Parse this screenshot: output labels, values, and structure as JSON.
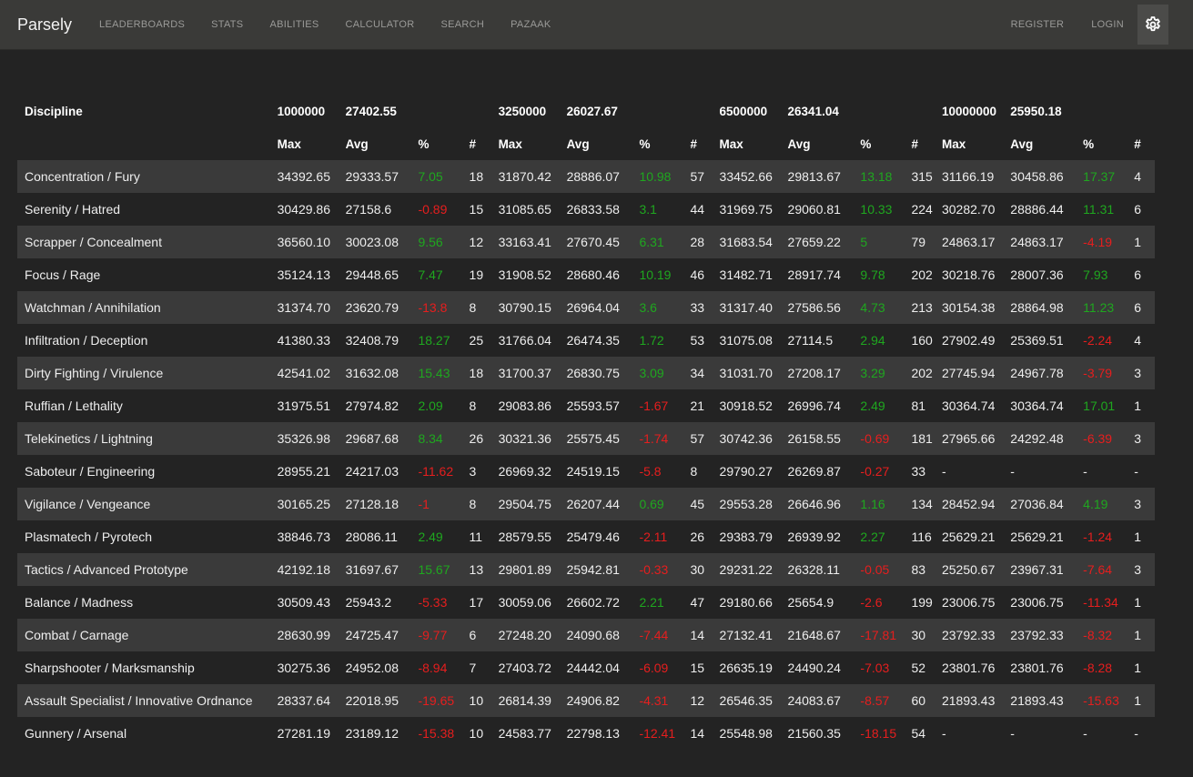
{
  "nav": {
    "brand": "Parsely",
    "links": [
      "LEADERBOARDS",
      "STATS",
      "ABILITIES",
      "CALCULATOR",
      "SEARCH",
      "PAZAAK"
    ],
    "register": "REGISTER",
    "login": "LOGIN"
  },
  "table": {
    "discipline_header": "Discipline",
    "groups": [
      {
        "hp": "1000000",
        "avg": "27402.55"
      },
      {
        "hp": "3250000",
        "avg": "26027.67"
      },
      {
        "hp": "6500000",
        "avg": "26341.04"
      },
      {
        "hp": "10000000",
        "avg": "25950.18"
      }
    ],
    "sub_headers": {
      "max": "Max",
      "avg": "Avg",
      "pct": "%",
      "count": "#"
    },
    "colors": {
      "positive": "#1fa71f",
      "negative": "#e61e1e"
    },
    "rows": [
      {
        "name": "Concentration / Fury",
        "cells": [
          [
            "34392.65",
            "29333.57",
            "7.05",
            "18"
          ],
          [
            "31870.42",
            "28886.07",
            "10.98",
            "57"
          ],
          [
            "33452.66",
            "29813.67",
            "13.18",
            "315"
          ],
          [
            "31166.19",
            "30458.86",
            "17.37",
            "4"
          ]
        ]
      },
      {
        "name": "Serenity / Hatred",
        "cells": [
          [
            "30429.86",
            "27158.6",
            "-0.89",
            "15"
          ],
          [
            "31085.65",
            "26833.58",
            "3.1",
            "44"
          ],
          [
            "31969.75",
            "29060.81",
            "10.33",
            "224"
          ],
          [
            "30282.70",
            "28886.44",
            "11.31",
            "6"
          ]
        ]
      },
      {
        "name": "Scrapper / Concealment",
        "cells": [
          [
            "36560.10",
            "30023.08",
            "9.56",
            "12"
          ],
          [
            "33163.41",
            "27670.45",
            "6.31",
            "28"
          ],
          [
            "31683.54",
            "27659.22",
            "5",
            "79"
          ],
          [
            "24863.17",
            "24863.17",
            "-4.19",
            "1"
          ]
        ]
      },
      {
        "name": "Focus / Rage",
        "cells": [
          [
            "35124.13",
            "29448.65",
            "7.47",
            "19"
          ],
          [
            "31908.52",
            "28680.46",
            "10.19",
            "46"
          ],
          [
            "31482.71",
            "28917.74",
            "9.78",
            "202"
          ],
          [
            "30218.76",
            "28007.36",
            "7.93",
            "6"
          ]
        ]
      },
      {
        "name": "Watchman / Annihilation",
        "cells": [
          [
            "31374.70",
            "23620.79",
            "-13.8",
            "8"
          ],
          [
            "30790.15",
            "26964.04",
            "3.6",
            "33"
          ],
          [
            "31317.40",
            "27586.56",
            "4.73",
            "213"
          ],
          [
            "30154.38",
            "28864.98",
            "11.23",
            "6"
          ]
        ]
      },
      {
        "name": "Infiltration / Deception",
        "cells": [
          [
            "41380.33",
            "32408.79",
            "18.27",
            "25"
          ],
          [
            "31766.04",
            "26474.35",
            "1.72",
            "53"
          ],
          [
            "31075.08",
            "27114.5",
            "2.94",
            "160"
          ],
          [
            "27902.49",
            "25369.51",
            "-2.24",
            "4"
          ]
        ]
      },
      {
        "name": "Dirty Fighting / Virulence",
        "cells": [
          [
            "42541.02",
            "31632.08",
            "15.43",
            "18"
          ],
          [
            "31700.37",
            "26830.75",
            "3.09",
            "34"
          ],
          [
            "31031.70",
            "27208.17",
            "3.29",
            "202"
          ],
          [
            "27745.94",
            "24967.78",
            "-3.79",
            "3"
          ]
        ]
      },
      {
        "name": "Ruffian / Lethality",
        "cells": [
          [
            "31975.51",
            "27974.82",
            "2.09",
            "8"
          ],
          [
            "29083.86",
            "25593.57",
            "-1.67",
            "21"
          ],
          [
            "30918.52",
            "26996.74",
            "2.49",
            "81"
          ],
          [
            "30364.74",
            "30364.74",
            "17.01",
            "1"
          ]
        ]
      },
      {
        "name": "Telekinetics / Lightning",
        "cells": [
          [
            "35326.98",
            "29687.68",
            "8.34",
            "26"
          ],
          [
            "30321.36",
            "25575.45",
            "-1.74",
            "57"
          ],
          [
            "30742.36",
            "26158.55",
            "-0.69",
            "181"
          ],
          [
            "27965.66",
            "24292.48",
            "-6.39",
            "3"
          ]
        ]
      },
      {
        "name": "Saboteur / Engineering",
        "cells": [
          [
            "28955.21",
            "24217.03",
            "-11.62",
            "3"
          ],
          [
            "26969.32",
            "24519.15",
            "-5.8",
            "8"
          ],
          [
            "29790.27",
            "26269.87",
            "-0.27",
            "33"
          ],
          [
            "-",
            "-",
            "-",
            "-"
          ]
        ]
      },
      {
        "name": "Vigilance / Vengeance",
        "cells": [
          [
            "30165.25",
            "27128.18",
            "-1",
            "8"
          ],
          [
            "29504.75",
            "26207.44",
            "0.69",
            "45"
          ],
          [
            "29553.28",
            "26646.96",
            "1.16",
            "134"
          ],
          [
            "28452.94",
            "27036.84",
            "4.19",
            "3"
          ]
        ]
      },
      {
        "name": "Plasmatech / Pyrotech",
        "cells": [
          [
            "38846.73",
            "28086.11",
            "2.49",
            "11"
          ],
          [
            "28579.55",
            "25479.46",
            "-2.11",
            "26"
          ],
          [
            "29383.79",
            "26939.92",
            "2.27",
            "116"
          ],
          [
            "25629.21",
            "25629.21",
            "-1.24",
            "1"
          ]
        ]
      },
      {
        "name": "Tactics / Advanced Prototype",
        "cells": [
          [
            "42192.18",
            "31697.67",
            "15.67",
            "13"
          ],
          [
            "29801.89",
            "25942.81",
            "-0.33",
            "30"
          ],
          [
            "29231.22",
            "26328.11",
            "-0.05",
            "83"
          ],
          [
            "25250.67",
            "23967.31",
            "-7.64",
            "3"
          ]
        ]
      },
      {
        "name": "Balance / Madness",
        "cells": [
          [
            "30509.43",
            "25943.2",
            "-5.33",
            "17"
          ],
          [
            "30059.06",
            "26602.72",
            "2.21",
            "47"
          ],
          [
            "29180.66",
            "25654.9",
            "-2.6",
            "199"
          ],
          [
            "23006.75",
            "23006.75",
            "-11.34",
            "1"
          ]
        ]
      },
      {
        "name": "Combat / Carnage",
        "cells": [
          [
            "28630.99",
            "24725.47",
            "-9.77",
            "6"
          ],
          [
            "27248.20",
            "24090.68",
            "-7.44",
            "14"
          ],
          [
            "27132.41",
            "21648.67",
            "-17.81",
            "30"
          ],
          [
            "23792.33",
            "23792.33",
            "-8.32",
            "1"
          ]
        ]
      },
      {
        "name": "Sharpshooter / Marksmanship",
        "cells": [
          [
            "30275.36",
            "24952.08",
            "-8.94",
            "7"
          ],
          [
            "27403.72",
            "24442.04",
            "-6.09",
            "15"
          ],
          [
            "26635.19",
            "24490.24",
            "-7.03",
            "52"
          ],
          [
            "23801.76",
            "23801.76",
            "-8.28",
            "1"
          ]
        ]
      },
      {
        "name": "Assault Specialist / Innovative Ordnance",
        "cells": [
          [
            "28337.64",
            "22018.95",
            "-19.65",
            "10"
          ],
          [
            "26814.39",
            "24906.82",
            "-4.31",
            "12"
          ],
          [
            "26546.35",
            "24083.67",
            "-8.57",
            "60"
          ],
          [
            "21893.43",
            "21893.43",
            "-15.63",
            "1"
          ]
        ]
      },
      {
        "name": "Gunnery / Arsenal",
        "cells": [
          [
            "27281.19",
            "23189.12",
            "-15.38",
            "10"
          ],
          [
            "24583.77",
            "22798.13",
            "-12.41",
            "14"
          ],
          [
            "25548.98",
            "21560.35",
            "-18.15",
            "54"
          ],
          [
            "-",
            "-",
            "-",
            "-"
          ]
        ]
      }
    ]
  }
}
